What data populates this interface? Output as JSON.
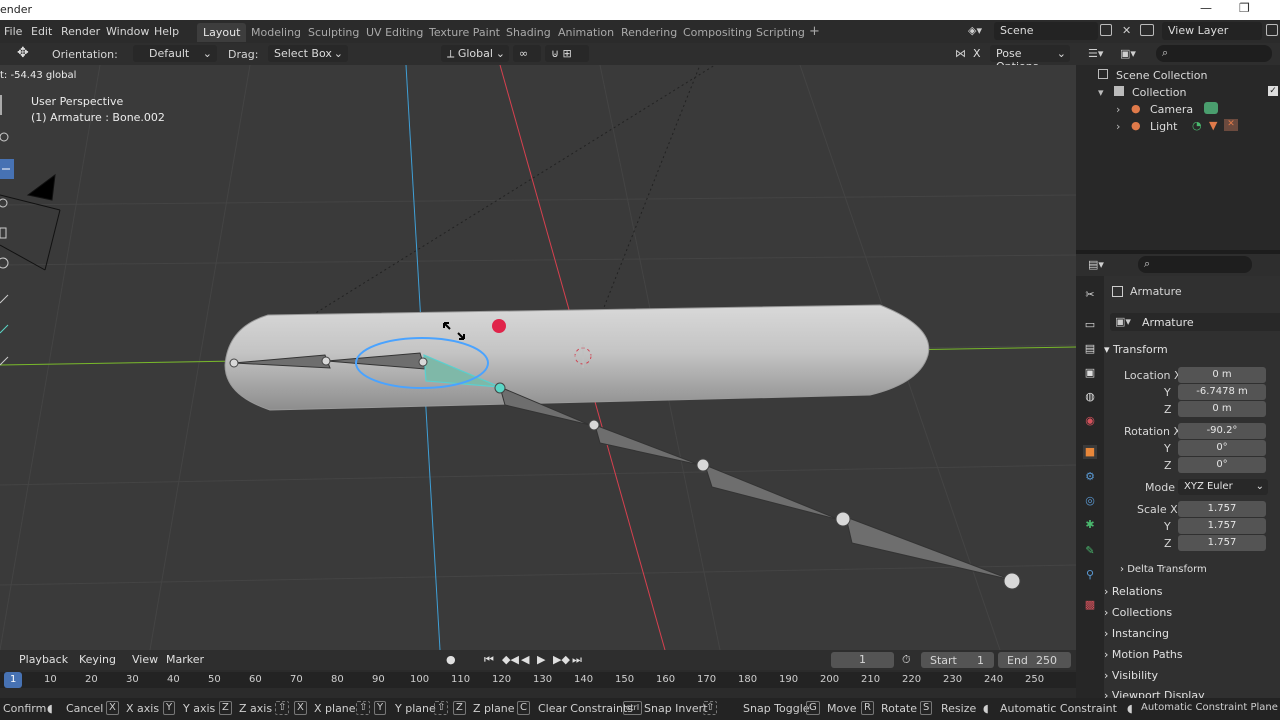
{
  "window": {
    "title_fragment": "ender",
    "min": "—",
    "max": "❐"
  },
  "menubar": {
    "items": [
      "File",
      "Edit",
      "Render",
      "Window",
      "Help"
    ]
  },
  "workspaces": [
    "Layout",
    "Modeling",
    "Sculpting",
    "UV Editing",
    "Texture Paint",
    "Shading",
    "Animation",
    "Rendering",
    "Compositing",
    "Scripting"
  ],
  "add_tab": "+",
  "scene": {
    "name": "Scene",
    "view_layer": "View Layer"
  },
  "header": {
    "orientation_label": "Orientation:",
    "orientation_value": "Default",
    "drag_label": "Drag:",
    "drag_value": "Select Box",
    "transform_orientation": "Global",
    "pose_options": "Pose Options",
    "x_mirror": "X"
  },
  "viewport": {
    "operator_readout": "t: -54.43 global",
    "view_name": "User Perspective",
    "selection_info": "(1) Armature : Bone.002"
  },
  "outliner": {
    "rows": [
      {
        "name": "Scene Collection",
        "icon": "scene-collection-icon"
      },
      {
        "name": "Collection",
        "icon": "collection-icon"
      },
      {
        "name": "Camera",
        "icon": "camera-icon"
      },
      {
        "name": "Light",
        "icon": "light-icon"
      }
    ]
  },
  "properties": {
    "object_name": "Armature",
    "datablock_name": "Armature",
    "transform_label": "Transform",
    "location": {
      "label_x": "Location X",
      "label_y": "Y",
      "label_z": "Z",
      "x": "0 m",
      "y": "-6.7478 m",
      "z": "0 m"
    },
    "rotation": {
      "label_x": "Rotation X",
      "label_y": "Y",
      "label_z": "Z",
      "x": "-90.2°",
      "y": "0°",
      "z": "0°"
    },
    "mode": {
      "label": "Mode",
      "value": "XYZ Euler"
    },
    "scale": {
      "label_x": "Scale X",
      "label_y": "Y",
      "label_z": "Z",
      "x": "1.757",
      "y": "1.757",
      "z": "1.757"
    },
    "subsections": [
      "Delta Transform",
      "Relations",
      "Collections",
      "Instancing",
      "Motion Paths",
      "Visibility",
      "Viewport Display"
    ]
  },
  "timeline": {
    "menus": [
      "Playback",
      "Keying",
      "View",
      "Marker"
    ],
    "current_frame": "1",
    "start_label": "Start",
    "start": "1",
    "end_label": "End",
    "end": "250",
    "ruler_marks": [
      "1",
      "10",
      "20",
      "30",
      "40",
      "50",
      "60",
      "70",
      "80",
      "90",
      "100",
      "110",
      "120",
      "130",
      "140",
      "150",
      "160",
      "170",
      "180",
      "190",
      "200",
      "210",
      "220",
      "230",
      "240",
      "250"
    ]
  },
  "statusbar": {
    "items": [
      {
        "key": "",
        "text": "Confirm"
      },
      {
        "key": "",
        "text": "Cancel"
      },
      {
        "key": "X",
        "text": "X axis"
      },
      {
        "key": "Y",
        "text": "Y axis"
      },
      {
        "key": "Z",
        "text": "Z axis"
      },
      {
        "key": "X",
        "text": "X plane"
      },
      {
        "key": "Y",
        "text": "Y plane"
      },
      {
        "key": "Z",
        "text": "Z plane"
      },
      {
        "key": "C",
        "text": "Clear Constraints"
      },
      {
        "key": "ctrl",
        "text": "Snap Invert"
      },
      {
        "key": "",
        "text": "Snap Toggle"
      },
      {
        "key": "G",
        "text": "Move"
      },
      {
        "key": "R",
        "text": "Rotate"
      },
      {
        "key": "S",
        "text": "Resize"
      },
      {
        "key": "",
        "text": "Automatic Constraint"
      },
      {
        "key": "",
        "text": "Automatic Constraint Plane"
      }
    ]
  },
  "colors": {
    "accent": "#4772b3",
    "selection": "#4aa3ff",
    "x_axis": "#d6404f",
    "y_axis": "#78b82a",
    "z_axis": "#3f9fd6"
  }
}
